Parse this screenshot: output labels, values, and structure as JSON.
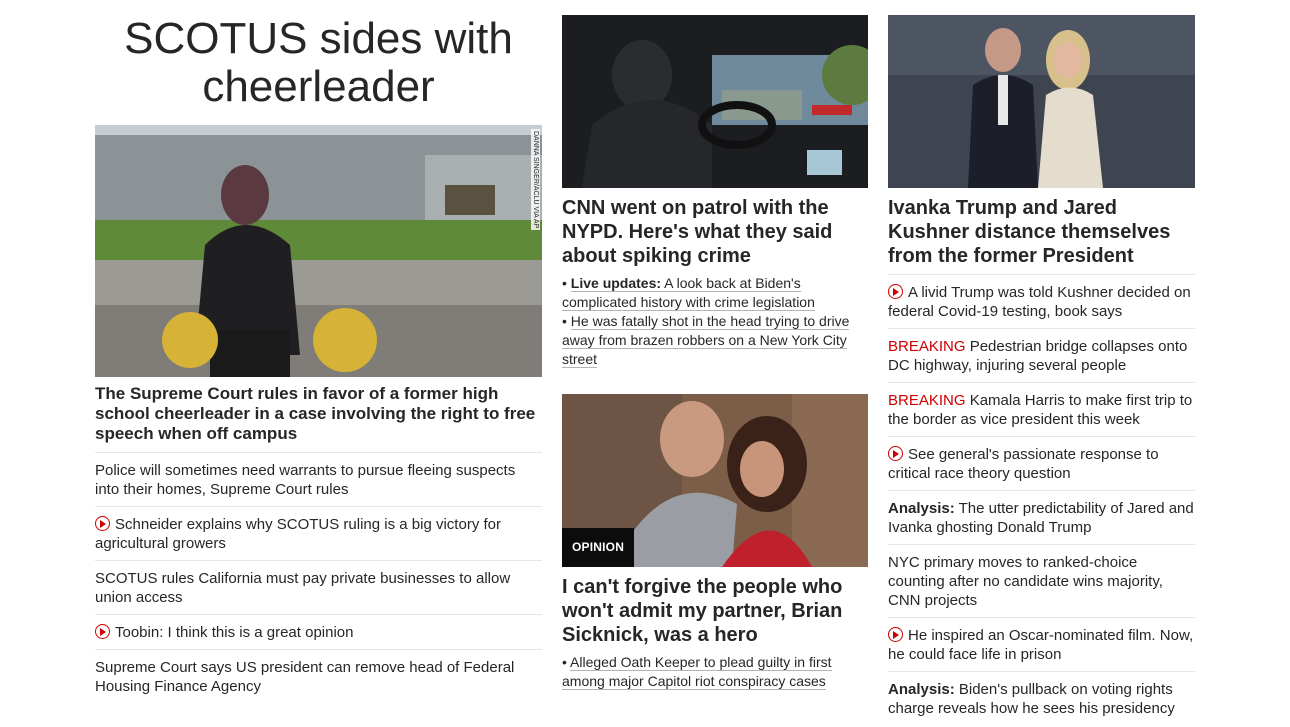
{
  "col1": {
    "banner": "SCOTUS sides with cheerleader",
    "photo_credit": "DANNA SINGER/ACLU VIA AP",
    "lead": "The Supreme Court rules in favor of a former high school cheerleader in a case involving the right to free speech when off campus",
    "items": [
      {
        "text": "Police will sometimes need warrants to pursue fleeing suspects into their homes, Supreme Court rules",
        "icon": ""
      },
      {
        "text": "Schneider explains why SCOTUS ruling is a big victory for agricultural growers",
        "icon": "play-icon"
      },
      {
        "text": "SCOTUS rules California must pay private businesses to allow union access",
        "icon": ""
      },
      {
        "text": "Toobin: I think this is a great opinion",
        "icon": "play-icon"
      },
      {
        "text": "Supreme Court says US president can remove head of Federal Housing Finance Agency",
        "icon": ""
      }
    ]
  },
  "col2": {
    "story1": {
      "headline": "CNN went on patrol with the NYPD. Here's what they said about spiking crime",
      "sub1_bold": "Live updates:",
      "sub1": "A look back at Biden's complicated history with crime legislation",
      "sub2": "He was fatally shot in the head trying to drive away from brazen robbers on a New York City street"
    },
    "story2": {
      "tag": "OPINION",
      "headline": "I can't forgive the people who won't admit my partner, Brian Sicknick, was a hero",
      "sub1": "Alleged Oath Keeper to plead guilty in first among major Capitol riot conspiracy cases"
    }
  },
  "col3": {
    "headline": "Ivanka Trump and Jared Kushner distance themselves from the former President",
    "items": [
      {
        "prefix": "",
        "text": "A livid Trump was told Kushner decided on federal Covid-19 testing, book says",
        "icon": "play-icon"
      },
      {
        "prefix": "BREAKING",
        "text": "Pedestrian bridge collapses onto DC highway, injuring several people",
        "icon": ""
      },
      {
        "prefix": "BREAKING",
        "text": "Kamala Harris to make first trip to the border as vice president this week",
        "icon": ""
      },
      {
        "prefix": "",
        "text": "See general's passionate response to critical race theory question",
        "icon": "play-icon"
      },
      {
        "prefix": "Analysis:",
        "text": "The utter predictability of Jared and Ivanka ghosting Donald Trump",
        "icon": ""
      },
      {
        "prefix": "",
        "text": "NYC primary moves to ranked-choice counting after no candidate wins majority, CNN projects",
        "icon": ""
      },
      {
        "prefix": "",
        "text": "He inspired an Oscar-nominated film. Now, he could face life in prison",
        "icon": "play-icon"
      },
      {
        "prefix": "Analysis:",
        "text": "Biden's pullback on voting rights charge reveals how he sees his presidency",
        "icon": ""
      }
    ]
  },
  "colors": {
    "accent": "#cc0000",
    "text": "#262626",
    "divider": "#e6e6e6"
  }
}
